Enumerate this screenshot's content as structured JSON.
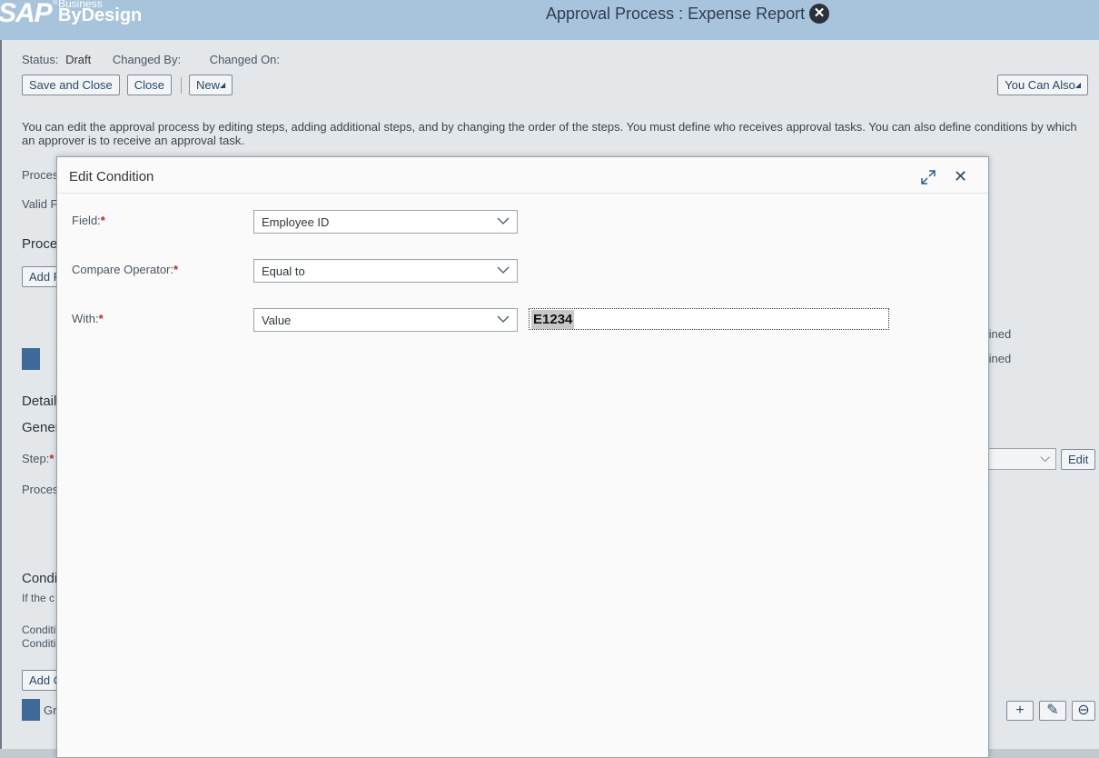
{
  "shell": {
    "logo_main": "SAP",
    "logo_business": "Business",
    "logo_bydesign": "ByDesign",
    "logo_registered": "®",
    "title": "Approval Process : Expense Report",
    "close_symbol": "✕"
  },
  "page": {
    "status_label": "Status:",
    "status_value": "Draft",
    "changed_by_label": "Changed By:",
    "changed_on_label": "Changed On:",
    "toolbar": {
      "save_close": "Save and Close",
      "close": "Close",
      "new": "New",
      "you_can_also": "You Can Also"
    },
    "hint": "You can edit the approval process by editing steps, adding additional steps, and by changing the order of the steps. You must define who receives approval tasks. You can also define conditions by which an approver is to receive an approval task.",
    "fragments": {
      "proces": "Proces",
      "valid": "Valid F",
      "proce_heading": "Proce",
      "add_r": "Add R",
      "detail": "Detail",
      "gener": "Gener",
      "step": "Step:",
      "proces2": "Proces",
      "condi": "Condi",
      "if_the": "If the c",
      "conditi1": "Conditi",
      "conditi2": "Conditi",
      "add_c": "Add C",
      "gr": "Gr",
      "fined1": "fined",
      "fined2": "fined",
      "edit": "Edit"
    }
  },
  "dialog": {
    "title": "Edit Condition",
    "fields": [
      {
        "label": "Field:",
        "value": "Employee ID"
      },
      {
        "label": "Compare Operator:",
        "value": "Equal to"
      },
      {
        "label": "With:",
        "value": "Value"
      }
    ],
    "value_input": "E1234",
    "required_mark": "*",
    "close_symbol": "✕"
  }
}
